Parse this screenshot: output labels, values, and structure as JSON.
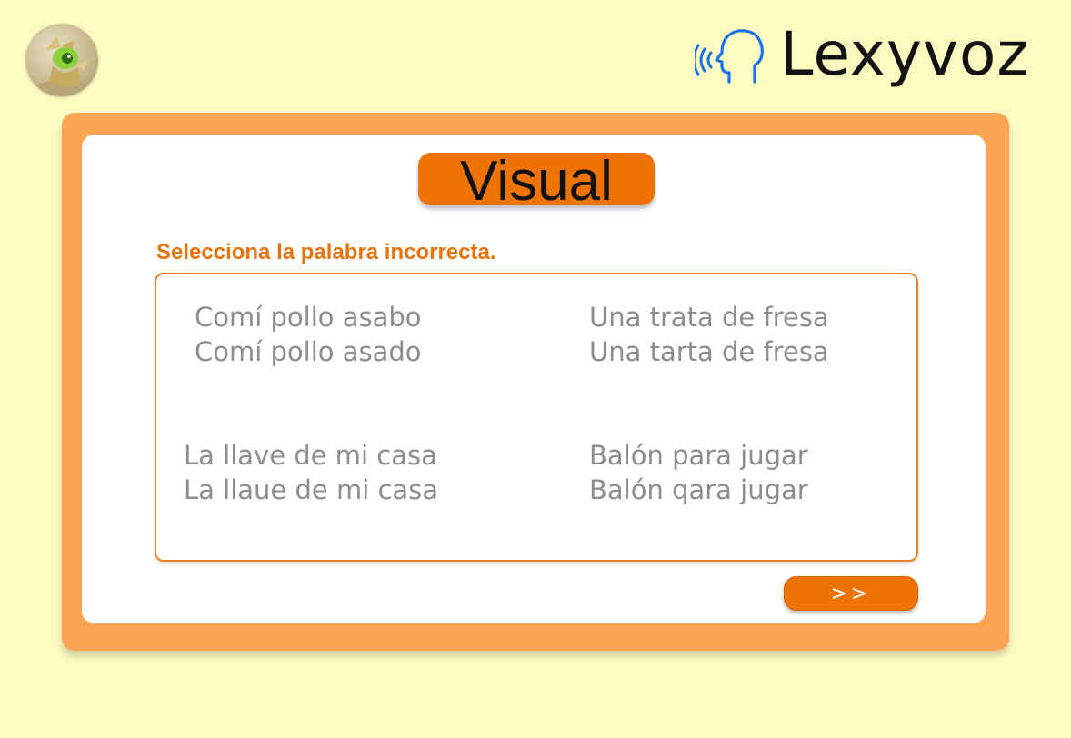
{
  "header": {
    "avatar_icon": "mascot-avatar-icon",
    "brand_icon": "speaking-head-icon",
    "brand_name": "Lexyvoz",
    "brand_icon_color": "#1a73e8"
  },
  "card": {
    "title": "Visual",
    "instruction": "Selecciona la palabra incorrecta.",
    "options": [
      {
        "line1": "Comí pollo asabo",
        "line2": "Comí pollo asado"
      },
      {
        "line1": "Una trata de fresa",
        "line2": "Una tarta de fresa"
      },
      {
        "line1": "La llave de mi casa",
        "line2": "La llaue de mi casa"
      },
      {
        "line1": "Balón para jugar",
        "line2": "Balón qara jugar"
      }
    ],
    "next_label": ">>"
  },
  "colors": {
    "background": "#fefbc1",
    "frame": "#fca453",
    "accent": "#ee7302",
    "instruction": "#e8730b",
    "option_text": "#8d8d8d"
  }
}
